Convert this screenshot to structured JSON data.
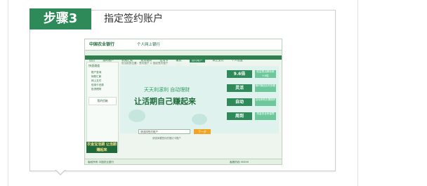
{
  "step": {
    "badge": "步骤3",
    "title": "指定签约账户"
  },
  "screenshot": {
    "bank_name": "中国农业银行",
    "subtitle": "个人网上银行",
    "nav": [
      "首页",
      "我的账户",
      "转账汇款",
      "投资理财",
      "信用卡",
      "缴费",
      "签约账户",
      "网上支付",
      "个人设置"
    ],
    "active_nav_index": 6,
    "subnav": [
      "账户查询",
      "签约账户",
      "活期收益",
      "理财产品",
      "基金",
      "保险",
      "贵金属"
    ],
    "breadcrumb": "您当前的位置：签约账户 > 指定签约账户",
    "sidebar": {
      "header": "快速通道",
      "items": [
        "账户查询",
        "转账汇款",
        "网上支付",
        "信用卡还款",
        "投资理财"
      ],
      "mailbox": "我的信箱"
    },
    "promo": "农金宝活期 让活期赚起来",
    "slogan_line1": "天天利滚利 自动理财",
    "slogan_line2": "让活期自己赚起来",
    "features": [
      {
        "label": "9.6倍",
        "desc": "收益是活期存款9.6倍"
      },
      {
        "label": "灵活",
        "desc": "随时赎回实时到账"
      },
      {
        "label": "自动",
        "desc": "自动申购无需操作"
      },
      {
        "label": "周到",
        "desc": "资金安全有保障"
      }
    ],
    "account_select": "请选择签约账户",
    "next_button": "下一步",
    "hint": "请选择要签约的借记卡账户",
    "footer_left": "版权所有 中国农业银行",
    "footer_right": "客服热线 95599"
  },
  "colors": {
    "accent": "#2f8a5a",
    "button": "#f1a21e"
  }
}
